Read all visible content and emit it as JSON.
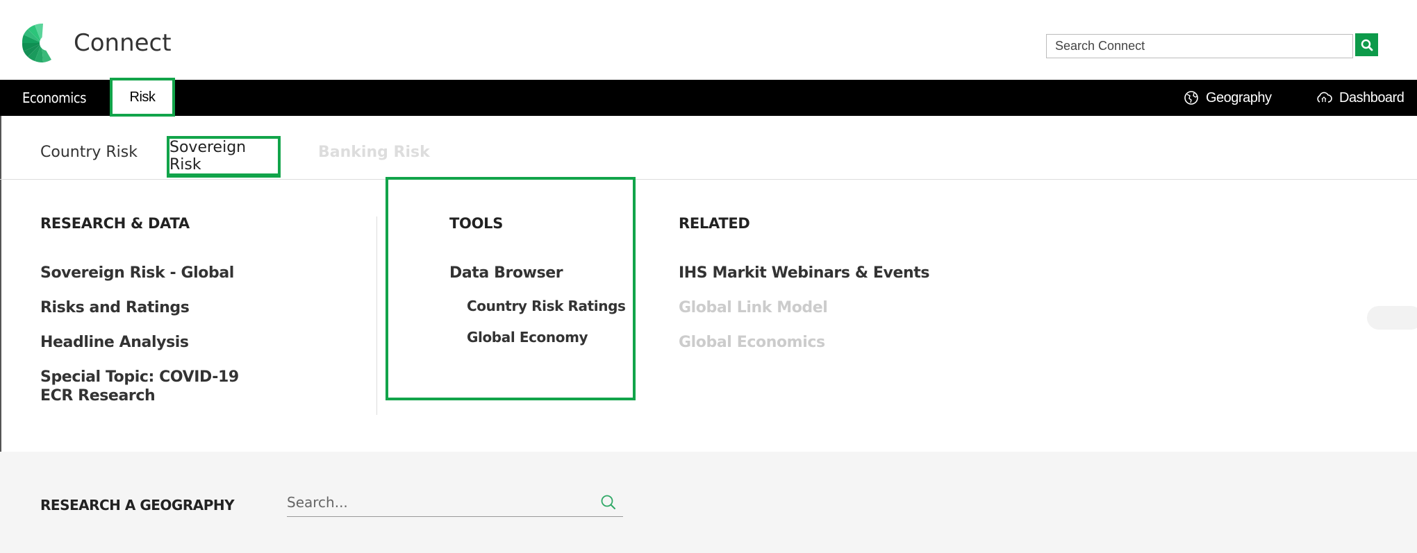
{
  "header": {
    "app_title": "Connect",
    "search_placeholder": "Search Connect"
  },
  "navbar": {
    "items": [
      {
        "label": "Economics"
      },
      {
        "label": "Risk",
        "active": true
      }
    ],
    "right": [
      {
        "label": "Geography",
        "icon": "globe-icon"
      },
      {
        "label": "Dashboard",
        "icon": "cloud-icon"
      }
    ]
  },
  "subtabs": [
    {
      "label": "Country Risk"
    },
    {
      "label": "Sovereign Risk",
      "active": true
    },
    {
      "label": "Banking Risk",
      "disabled": true
    }
  ],
  "menu": {
    "research": {
      "heading": "RESEARCH & DATA",
      "links": [
        "Sovereign Risk - Global",
        "Risks and Ratings",
        "Headline Analysis",
        "Special Topic: COVID-19 ECR Research"
      ]
    },
    "tools": {
      "heading": "TOOLS",
      "links": [
        "Data Browser"
      ],
      "sublinks": [
        "Country Risk Ratings",
        "Global Economy"
      ]
    },
    "related": {
      "heading": "RELATED",
      "links": [
        {
          "label": "IHS Markit Webinars & Events",
          "muted": false
        },
        {
          "label": "Global Link Model",
          "muted": true
        },
        {
          "label": "Global Economics",
          "muted": true
        }
      ]
    }
  },
  "geography": {
    "label": "RESEARCH A GEOGRAPHY",
    "search_placeholder": "Search..."
  },
  "colors": {
    "accent": "#12a44a",
    "navbar_bg": "#000000",
    "search_button": "#0d9a4a"
  }
}
